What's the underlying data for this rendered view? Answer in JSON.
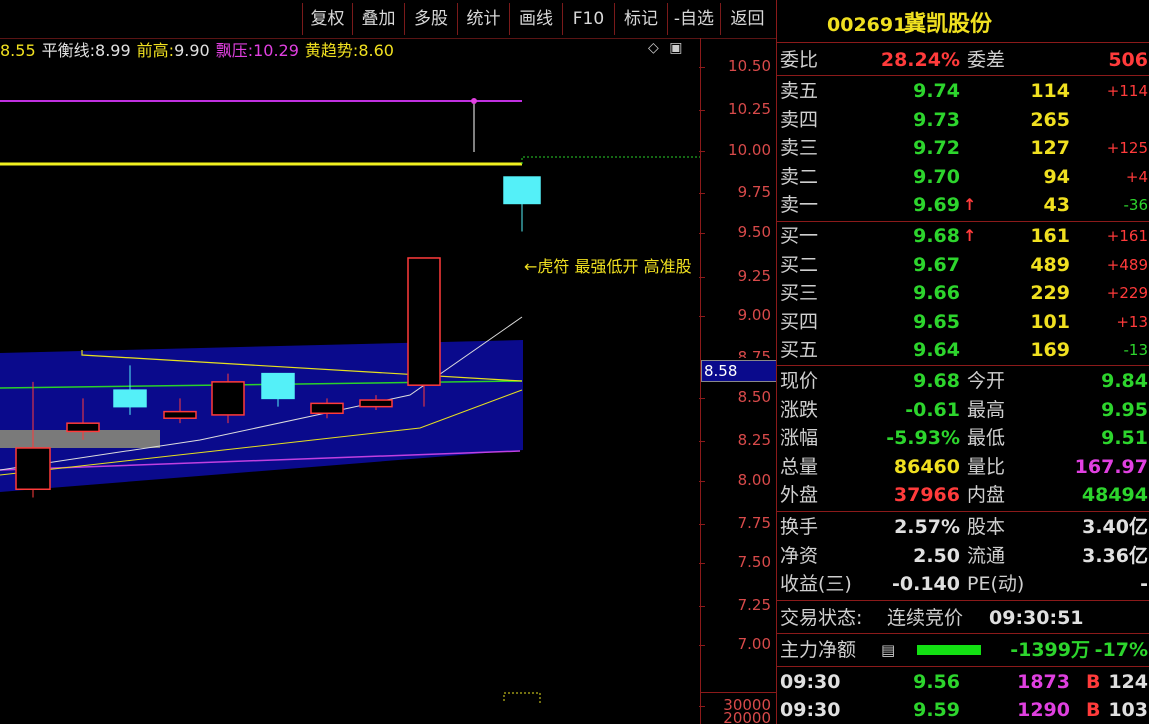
{
  "toolbar": {
    "buttons": [
      "复权",
      "叠加",
      "多股",
      "统计",
      "画线",
      "F10",
      "标记",
      "-自选",
      "返回"
    ]
  },
  "indicators": {
    "first_value": "8.55",
    "balance_label": "平衡线:",
    "balance_value": "8.99",
    "prev_high_label": "前高:",
    "prev_high_value": "9.90",
    "float_label": "飘压:",
    "float_value": "10.29",
    "trend_label": "黄趋势:",
    "trend_value": "8.60",
    "icons": [
      "diamond-icon",
      "window-icon"
    ]
  },
  "chart": {
    "annotation": "←虎符 最强低开 高准股",
    "current_price_tag": "8.58",
    "y_ticks": [
      "10.50",
      "10.25",
      "10.00",
      "9.75",
      "9.50",
      "9.25",
      "9.00",
      "8.75",
      "8.50",
      "8.25",
      "8.00",
      "7.75",
      "7.50",
      "7.25",
      "7.00"
    ],
    "volume_ticks": [
      "30000",
      "20000"
    ],
    "candles": [
      {
        "o": 8.2,
        "c": 7.95,
        "h": 8.6,
        "l": 7.9
      },
      {
        "o": 8.35,
        "c": 8.3,
        "h": 8.5,
        "l": 8.25
      },
      {
        "o": 8.55,
        "c": 8.45,
        "h": 8.7,
        "l": 8.4
      },
      {
        "o": 8.42,
        "c": 8.38,
        "h": 8.5,
        "l": 8.35
      },
      {
        "o": 8.6,
        "c": 8.4,
        "h": 8.65,
        "l": 8.35
      },
      {
        "o": 8.65,
        "c": 8.5,
        "h": 8.65,
        "l": 8.45
      },
      {
        "o": 8.47,
        "c": 8.41,
        "h": 8.5,
        "l": 8.38
      },
      {
        "o": 8.49,
        "c": 8.45,
        "h": 8.52,
        "l": 8.43
      },
      {
        "o": 8.58,
        "c": 9.35,
        "h": 9.35,
        "l": 8.45
      },
      {
        "o": 9.84,
        "c": 9.68,
        "h": 9.84,
        "l": 9.51
      }
    ]
  },
  "quote": {
    "code": "002691",
    "name": "冀凯股份",
    "weibi_label": "委比",
    "weibi_value": "28.24%",
    "weicha_label": "委差",
    "weicha_value": "506",
    "sells": [
      {
        "label": "卖五",
        "price": "9.74",
        "vol": "114",
        "chg": "+114",
        "arrow": ""
      },
      {
        "label": "卖四",
        "price": "9.73",
        "vol": "265",
        "chg": "",
        "arrow": ""
      },
      {
        "label": "卖三",
        "price": "9.72",
        "vol": "127",
        "chg": "+125",
        "arrow": ""
      },
      {
        "label": "卖二",
        "price": "9.70",
        "vol": "94",
        "chg": "+4",
        "arrow": ""
      },
      {
        "label": "卖一",
        "price": "9.69",
        "vol": "43",
        "chg": "-36",
        "arrow": "↑"
      }
    ],
    "buys": [
      {
        "label": "买一",
        "price": "9.68",
        "vol": "161",
        "chg": "+161",
        "arrow": "↑"
      },
      {
        "label": "买二",
        "price": "9.67",
        "vol": "489",
        "chg": "+489",
        "arrow": ""
      },
      {
        "label": "买三",
        "price": "9.66",
        "vol": "229",
        "chg": "+229",
        "arrow": ""
      },
      {
        "label": "买四",
        "price": "9.65",
        "vol": "101",
        "chg": "+13",
        "arrow": ""
      },
      {
        "label": "买五",
        "price": "9.64",
        "vol": "169",
        "chg": "-13",
        "arrow": ""
      }
    ],
    "stats": [
      {
        "l1": "现价",
        "v1": "9.68",
        "c1": "g",
        "l2": "今开",
        "v2": "9.84",
        "c2": "g"
      },
      {
        "l1": "涨跌",
        "v1": "-0.61",
        "c1": "g",
        "l2": "最高",
        "v2": "9.95",
        "c2": "g"
      },
      {
        "l1": "涨幅",
        "v1": "-5.93%",
        "c1": "g",
        "l2": "最低",
        "v2": "9.51",
        "c2": "g"
      },
      {
        "l1": "总量",
        "v1": "86460",
        "c1": "y",
        "l2": "量比",
        "v2": "167.97",
        "c2": "m"
      },
      {
        "l1": "外盘",
        "v1": "37966",
        "c1": "r",
        "l2": "内盘",
        "v2": "48494",
        "c2": "g"
      }
    ],
    "stats2": [
      {
        "l1": "换手",
        "v1": "2.57%",
        "l2": "股本",
        "v2": "3.40亿"
      },
      {
        "l1": "净资",
        "v1": "2.50",
        "l2": "流通",
        "v2": "3.36亿"
      },
      {
        "l1": "收益(三)",
        "v1": "-0.140",
        "l2": "PE(动)",
        "v2": "-"
      }
    ],
    "trade_status_label": "交易状态:",
    "trade_status_value": "连续竞价",
    "trade_time": "09:30:51",
    "main_force_label": "主力净额",
    "main_force_value": "-1399万",
    "main_force_pct": "-17%",
    "ticks": [
      {
        "time": "09:30",
        "price": "9.56",
        "vol": "1873",
        "side": "B",
        "num": "124"
      },
      {
        "time": "09:30",
        "price": "9.59",
        "vol": "1290",
        "side": "B",
        "num": "103"
      }
    ]
  },
  "colors": {
    "up": "#ff3b3b",
    "down": "#2dd52d",
    "band": "#0a0a8c",
    "cyan": "#54f0f8"
  }
}
